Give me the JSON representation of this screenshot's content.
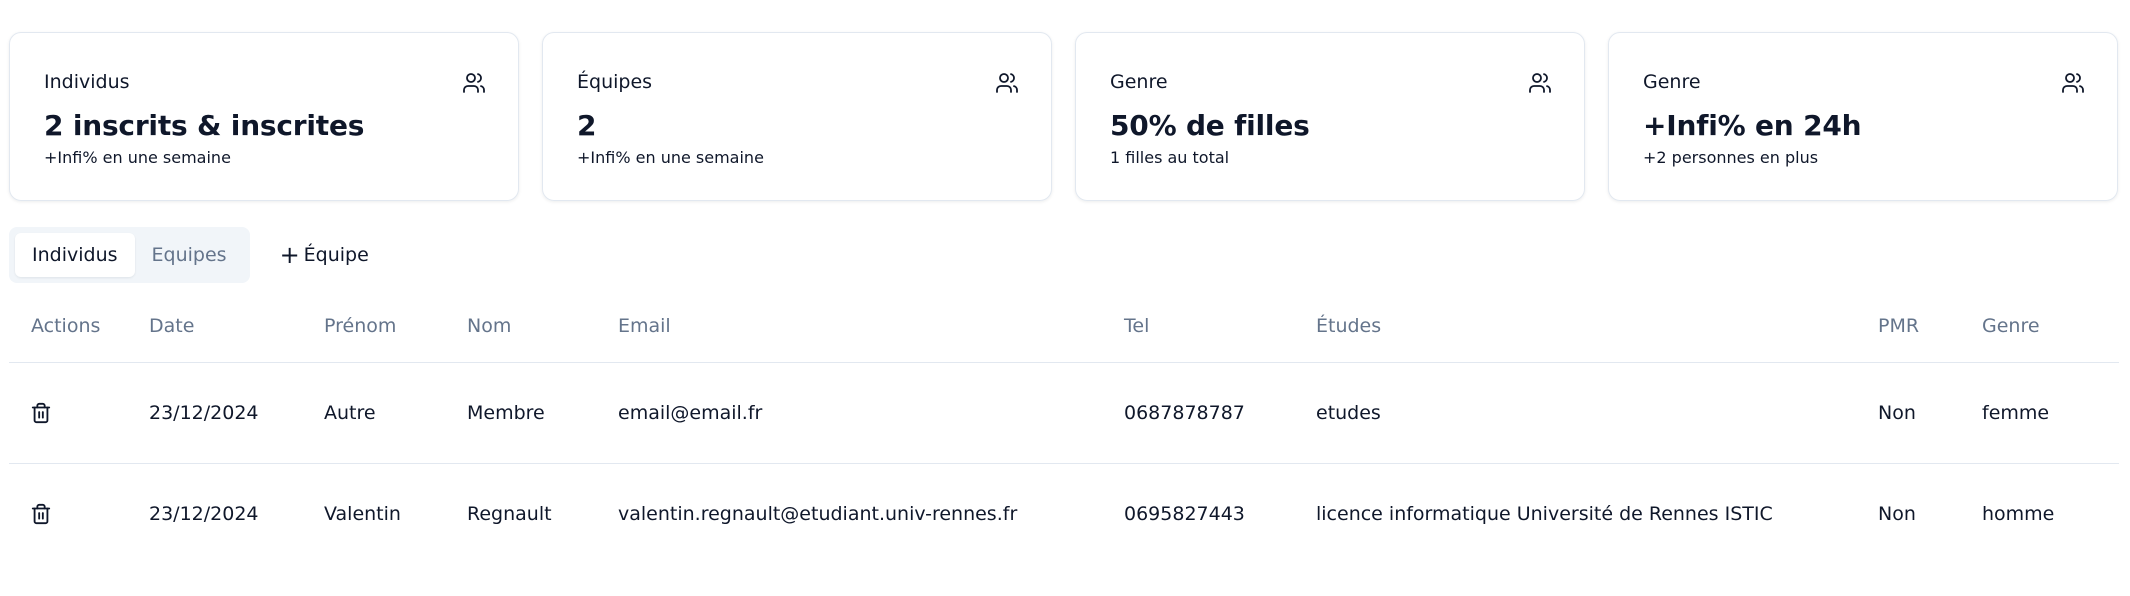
{
  "stats": [
    {
      "title": "Individus",
      "value": "2 inscrits & inscrites",
      "sub": "+Infi% en une semaine",
      "icon": "users-icon"
    },
    {
      "title": "Équipes",
      "value": "2",
      "sub": "+Infi% en une semaine",
      "icon": "users-icon"
    },
    {
      "title": "Genre",
      "value": "50% de filles",
      "sub": "1 filles au total",
      "icon": "users-icon"
    },
    {
      "title": "Genre",
      "value": "+Infi% en 24h",
      "sub": "+2 personnes en plus",
      "icon": "users-icon"
    }
  ],
  "tabs": [
    {
      "label": "Individus",
      "active": true
    },
    {
      "label": "Equipes",
      "active": false
    }
  ],
  "add_team": {
    "icon": "plus-icon",
    "label": "Équipe"
  },
  "table": {
    "headers": {
      "actions": "Actions",
      "date": "Date",
      "prenom": "Prénom",
      "nom": "Nom",
      "email": "Email",
      "tel": "Tel",
      "etudes": "Études",
      "pmr": "PMR",
      "genre": "Genre"
    },
    "rows": [
      {
        "date": "23/12/2024",
        "prenom": "Autre",
        "nom": "Membre",
        "email": "email@email.fr",
        "tel": "0687878787",
        "etudes": "etudes",
        "pmr": "Non",
        "genre": "femme"
      },
      {
        "date": "23/12/2024",
        "prenom": "Valentin",
        "nom": "Regnault",
        "email": "valentin.regnault@etudiant.univ-rennes.fr",
        "tel": "0695827443",
        "etudes": "licence informatique Université de Rennes ISTIC",
        "pmr": "Non",
        "genre": "homme"
      }
    ],
    "row_action_icon": "trash-icon"
  }
}
